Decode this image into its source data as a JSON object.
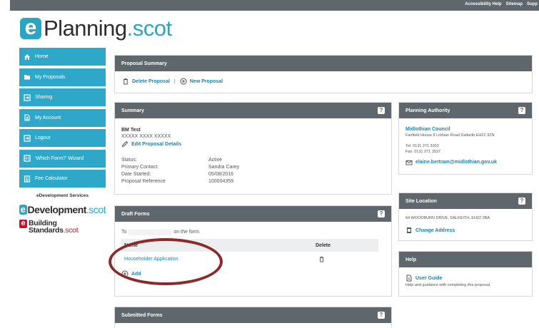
{
  "topbar": {
    "links": [
      "Accessibility Help",
      "Sitemap",
      "Supp"
    ]
  },
  "logo": {
    "e": "e",
    "word1": "Planning",
    "word2": ".scot"
  },
  "sidebar": {
    "items": [
      {
        "label": "Home",
        "icon": "home-icon"
      },
      {
        "label": "My Proposals",
        "icon": "folder-icon"
      },
      {
        "label": "Sharing",
        "icon": "share-icon"
      },
      {
        "label": "My Account",
        "icon": "account-icon"
      },
      {
        "label": "Logout",
        "icon": "logout-icon"
      },
      {
        "label": "'Which Form?' Wizard",
        "icon": "wizard-icon"
      },
      {
        "label": "Fee Calculator",
        "icon": "calculator-icon"
      }
    ],
    "edev_heading": "eDevelopment Services",
    "edev_brand": {
      "e": "e",
      "word": "Development",
      "suffix": ".scot"
    },
    "bs_brand": {
      "e": "e",
      "line1": "Building",
      "line2": "Standards",
      "suffix": ".scot"
    }
  },
  "proposal_summary": {
    "title": "Proposal Summary",
    "delete_label": "Delete Proposal",
    "separator": "|",
    "new_label": "New Proposal"
  },
  "summary": {
    "title": "Summary",
    "help": "?",
    "name": "BM Test",
    "address": "XXXXX XXXX XXXXX",
    "edit_label": "Edit Proposal Details",
    "fields": [
      {
        "label": "Status:",
        "value": "Active"
      },
      {
        "label": "Primary Contact:",
        "value": "Sandra Carey"
      },
      {
        "label": "Date Started:",
        "value": "05/08/2016"
      },
      {
        "label": "Proposal Reference",
        "value": "100004359"
      }
    ]
  },
  "draft_forms": {
    "title": "Draft Forms",
    "help": "?",
    "intro_start": "To",
    "intro_end": "on the form.",
    "col_name": "Name",
    "col_delete": "Delete",
    "rows": [
      {
        "name": "Householder Application"
      }
    ],
    "add_label": "Add"
  },
  "submitted_forms": {
    "title": "Submitted Forms",
    "help": "?"
  },
  "planning_authority": {
    "title": "Planning Authority",
    "help": "?",
    "council": "Midlothian Council",
    "address": "Fairfield House 8 Lothian Road Dalkeith EH22 3ZN",
    "tel": "Tel: 0131 271 3302",
    "fax": "Fax: 0131 271 3537",
    "email": "elaine.bertram@midlothian.gov.uk"
  },
  "site_location": {
    "title": "Site Location",
    "help": "?",
    "address": "64 WOODBURN DRIVE, DALKEITH, EH22 2BA",
    "change_label": "Change Address"
  },
  "help_panel": {
    "title": "Help",
    "guide_label": "User Guide",
    "guide_desc": "Help and guidance with completing this proposal."
  },
  "colors": {
    "accent": "#2fa7c8",
    "header": "#5f676c",
    "link": "#1d84ab",
    "annotation": "#8b2a2a"
  }
}
